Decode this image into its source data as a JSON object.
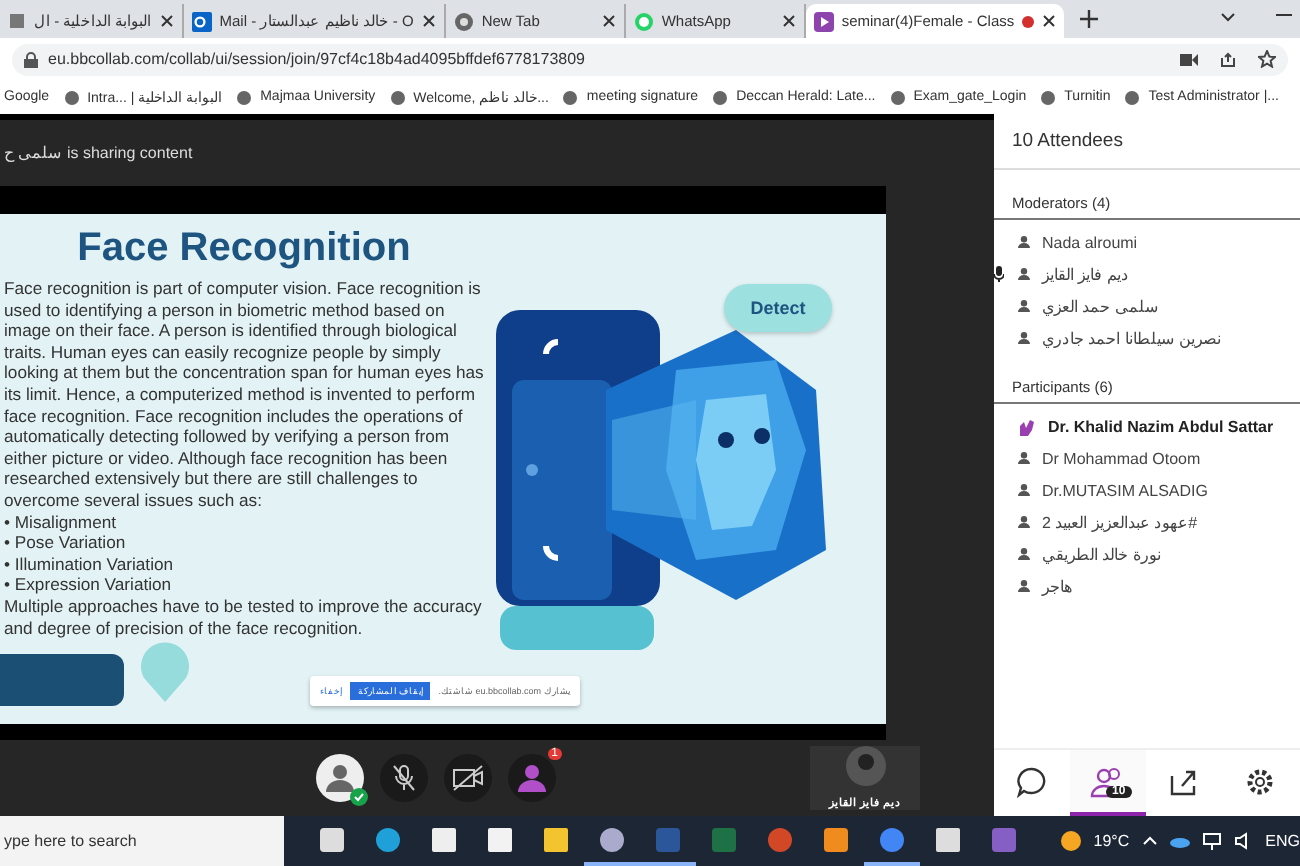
{
  "browser": {
    "tabs": [
      {
        "kind": "page",
        "title": "البوابة الداخلية - ال",
        "selected": false
      },
      {
        "kind": "mail",
        "title": "Mail - خالد ناظيم عبدالستار - O",
        "selected": false
      },
      {
        "kind": "chrome",
        "title": "New Tab",
        "selected": false
      },
      {
        "kind": "whatsapp",
        "title": "WhatsApp",
        "selected": false
      },
      {
        "kind": "collab",
        "title": "seminar(4)Female - Class",
        "selected": true
      }
    ],
    "address": "eu.bbcollab.com/collab/ui/session/join/97cf4c18b4ad4095bffdef6778173809",
    "bookmarks": [
      "Google",
      "Intra... | البوابة الداخلية",
      "Majmaa University",
      "Welcome, خالد ناظم...",
      "meeting signature",
      "Deccan Herald: Late...",
      "Exam_gate_Login",
      "Turnitin",
      "Test Administrator |..."
    ]
  },
  "session": {
    "sharing_notice": "سلمى ح is sharing content",
    "slide": {
      "title": "Face Recognition",
      "detect_label": "Detect",
      "paragraph": "Face recognition is part of computer vision. Face recognition is used to identifying a person in biometric method based on image on their face. A person is identified through biological traits. Human eyes can easily recognize people by simply looking at them but the concentration span for human eyes has its limit. Hence, a computerized method is invented to perform face recognition. Face recognition includes the operations of automatically detecting followed by verifying a person from either picture or video. Although face recognition has been researched extensively but there are still challenges to overcome several issues such as:",
      "bullets": [
        "• Misalignment",
        "• Pose Variation",
        "• Illumination Variation",
        "• Expression Variation"
      ],
      "closing": "Multiple approaches have to be tested to improve the accuracy and degree of precision of the face recognition.",
      "share_bar": {
        "message": "يشارك eu.bbcollab.com شاشتك.",
        "stop_button": "إيقاف المشاركة",
        "hide_link": "إخفاء"
      }
    },
    "controls": [
      {
        "kind": "avatar",
        "on": true
      },
      {
        "kind": "mic",
        "on": false
      },
      {
        "kind": "camera",
        "on": false
      },
      {
        "kind": "hand",
        "on": true,
        "badge": "1"
      }
    ],
    "video_tile": {
      "name": "ديم فايز القايز"
    }
  },
  "attendees": {
    "header": "10 Attendees",
    "sections": [
      {
        "title": "Moderators (4)",
        "members": [
          {
            "name": "Nada alroumi",
            "speaking": false,
            "hand_raised": false
          },
          {
            "name": "ديم فايز القايز",
            "speaking": true,
            "hand_raised": false
          },
          {
            "name": "سلمى حمد العزي",
            "speaking": false,
            "hand_raised": false
          },
          {
            "name": "نصرين سيلطانا احمد جادري",
            "speaking": false,
            "hand_raised": false
          }
        ]
      },
      {
        "title": "Participants (6)",
        "members": [
          {
            "name": "Dr. Khalid Nazim Abdul Sattar",
            "speaking": false,
            "hand_raised": true
          },
          {
            "name": "Dr Mohammad Otoom",
            "speaking": false,
            "hand_raised": false
          },
          {
            "name": "Dr.MUTASIM ALSADIG",
            "speaking": false,
            "hand_raised": false
          },
          {
            "name": "عهود عبدالعزيز العبيد 2#",
            "speaking": false,
            "hand_raised": false
          },
          {
            "name": "نورة خالد الطريقي",
            "speaking": false,
            "hand_raised": false
          },
          {
            "name": "هاجر",
            "speaking": false,
            "hand_raised": false
          }
        ]
      }
    ],
    "panel_tabs": [
      {
        "kind": "chat",
        "selected": false
      },
      {
        "kind": "attendees",
        "selected": true,
        "badge": "10"
      },
      {
        "kind": "share",
        "selected": false
      },
      {
        "kind": "settings",
        "selected": false
      }
    ]
  },
  "taskbar": {
    "search": {
      "placeholder": "ype here to search"
    },
    "apps": [
      {
        "kind": "taskview",
        "running": false
      },
      {
        "kind": "edge",
        "running": false
      },
      {
        "kind": "mail",
        "running": false
      },
      {
        "kind": "store",
        "running": false
      },
      {
        "kind": "explorer",
        "running": false
      },
      {
        "kind": "paint",
        "running": true
      },
      {
        "kind": "word",
        "running": true
      },
      {
        "kind": "excel",
        "running": false
      },
      {
        "kind": "powerpoint",
        "running": false
      },
      {
        "kind": "office",
        "running": false
      },
      {
        "kind": "chrome",
        "running": true
      },
      {
        "kind": "calculator",
        "running": false
      },
      {
        "kind": "visualstudio",
        "running": false
      }
    ],
    "weather": "19°C",
    "language": "ENG"
  }
}
